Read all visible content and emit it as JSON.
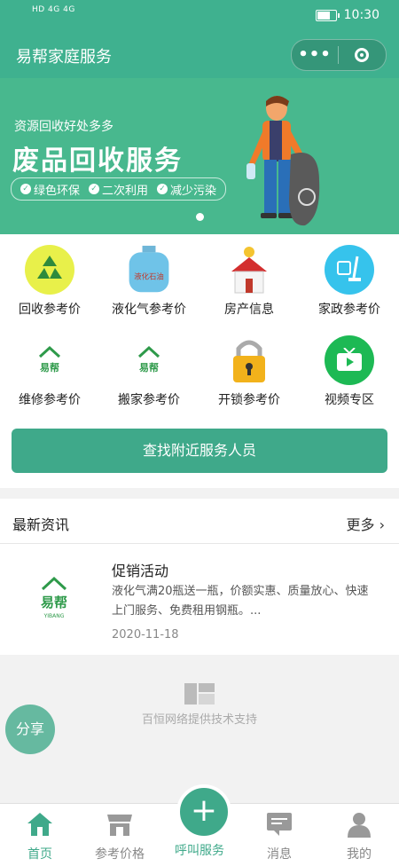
{
  "status": {
    "time": "10:30",
    "left": "HD 4G 4G"
  },
  "header": {
    "title": "易帮家庭服务",
    "menu_icon": "more-dots-icon",
    "close_icon": "target-icon"
  },
  "banner": {
    "tag": "资源回收好处多多",
    "headline": "废品回收服务",
    "pills": [
      "绿色环保",
      "二次利用",
      "减少污染"
    ]
  },
  "grid": {
    "items": [
      {
        "label": "回收参考价",
        "icon": "recycle-icon"
      },
      {
        "label": "液化气参考价",
        "icon": "gas-tank-icon",
        "icon_text": "液化石油"
      },
      {
        "label": "房产信息",
        "icon": "house-icon"
      },
      {
        "label": "家政参考价",
        "icon": "cleaning-icon"
      },
      {
        "label": "维修参考价",
        "icon": "yibang-logo-icon",
        "icon_text": "易帮"
      },
      {
        "label": "搬家参考价",
        "icon": "yibang-logo-icon",
        "icon_text": "易帮"
      },
      {
        "label": "开锁参考价",
        "icon": "padlock-icon"
      },
      {
        "label": "视频专区",
        "icon": "video-icon"
      }
    ]
  },
  "find_button": "查找附近服务人员",
  "news": {
    "title": "最新资讯",
    "more": "更多",
    "item": {
      "title": "促销活动",
      "desc": "液化气满20瓶送一瓶，价额实惠、质量放心、快速上门服务、免费租用钢瓶。...",
      "date": "2020-11-18",
      "logo_text": "易帮",
      "logo_sub": "YIBANG"
    }
  },
  "support": "百恒网络提供技术支持",
  "share": "分享",
  "tabs": [
    {
      "label": "首页",
      "icon": "home-icon"
    },
    {
      "label": "参考价格",
      "icon": "store-icon"
    },
    {
      "label": "呼叫服务",
      "icon": "plus-icon"
    },
    {
      "label": "消息",
      "icon": "message-icon"
    },
    {
      "label": "我的",
      "icon": "user-icon"
    }
  ],
  "colors": {
    "primary": "#3fb18f",
    "button": "#3fa98a"
  }
}
